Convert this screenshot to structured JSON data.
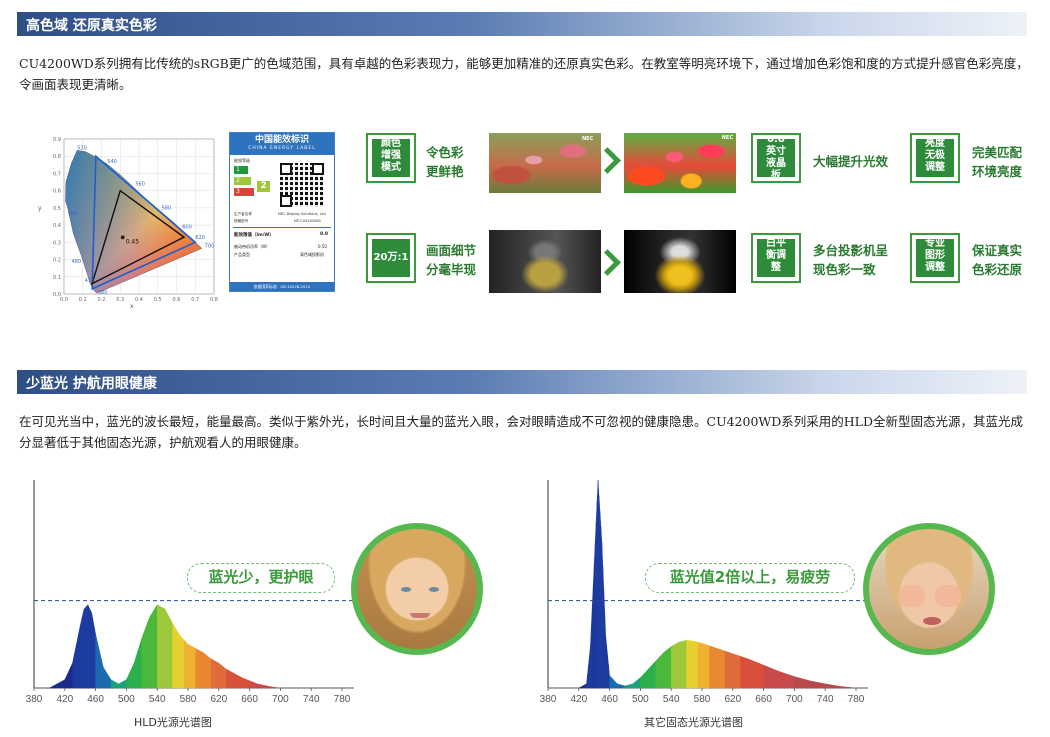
{
  "section1": {
    "heading": "高色域 还原真实色彩",
    "paragraph": "CU4200WD系列拥有比传统的sRGB更广的色域范围，具有卓越的色彩表现力，能够更加精准的还原真实色彩。在教室等明亮环境下，通过增加色彩饱和度的方式提升感官色彩亮度，令画面表现更清晰。"
  },
  "energy_label": {
    "title": "中国能效标识",
    "subtitle": "CHINA ENERGY LABEL",
    "grade_label": "能效等级",
    "grade_value": "2",
    "maker_label": "生产者名称",
    "maker_value": "NEC Display Solutions, Ltd.",
    "model_label": "规格型号",
    "model_value": "NP-CU4200WD",
    "row1_label": "能效限值（lm/W）",
    "row1_value": "8.0",
    "row2_label": "被动待机功率（W）",
    "row2_value": "0.50",
    "row3_label": "产品类型",
    "row3_value": "高色域投影机",
    "footer": "依据国家标准：GB 32028-2015"
  },
  "cie": {
    "xticks": [
      "0.0",
      "0.1",
      "0.2",
      "0.3",
      "0.4",
      "0.5",
      "0.6",
      "0.7",
      "0.8"
    ],
    "yticks": [
      "0.0",
      "0.1",
      "0.2",
      "0.3",
      "0.4",
      "0.5",
      "0.6",
      "0.7",
      "0.8",
      "0.9"
    ],
    "xlabel": "x",
    "ylabel": "y",
    "wavelengths": [
      "520",
      "540",
      "560",
      "580",
      "600",
      "620",
      "700",
      "490",
      "480",
      "470",
      "380"
    ],
    "white_point": "0.45"
  },
  "features": [
    {
      "icon_text": "颜色增强模式",
      "label1": "令色彩",
      "label2": "更鲜艳"
    },
    {
      "icon_text": "0.8英寸液晶板",
      "label1": "大幅提升光效",
      "label2": ""
    },
    {
      "icon_text": "亮度无极调整",
      "label1": "完美匹配",
      "label2": "环境亮度"
    },
    {
      "icon_text": "20万:1",
      "label1": "画面细节",
      "label2": "分毫毕现"
    },
    {
      "icon_text": "白平衡调整",
      "label1": "多台投影机呈",
      "label2": "现色彩一致"
    },
    {
      "icon_text": "专业图形调整",
      "label1": "保证真实",
      "label2": "色彩还原"
    }
  ],
  "photo_brand": "NEC",
  "section2": {
    "heading": "少蓝光 护航用眼健康",
    "paragraph": "在可见光当中，蓝光的波长最短，能量最高。类似于紫外光，长时间且大量的蓝光入眼，会对眼睛造成不可忽视的健康隐患。CU4200WD系列采用的HLD全新型固态光源，其蓝光成分显著低于其他固态光源，护航观看人的用眼健康。"
  },
  "chart_data": [
    {
      "type": "area",
      "title": "HLD光源光谱图",
      "xlabel": "",
      "ylabel": "",
      "x_ticks": [
        380,
        420,
        460,
        500,
        540,
        580,
        620,
        660,
        700,
        740,
        780
      ],
      "xlim": [
        380,
        780
      ],
      "ylim": [
        0,
        1
      ],
      "reference_line": 0.42,
      "badge": "蓝光少，更护眼",
      "x": [
        380,
        400,
        420,
        430,
        440,
        445,
        450,
        455,
        460,
        470,
        480,
        490,
        500,
        510,
        520,
        530,
        540,
        550,
        560,
        570,
        580,
        590,
        600,
        610,
        620,
        630,
        640,
        650,
        660,
        670,
        680,
        690,
        700
      ],
      "values": [
        0,
        0,
        0.04,
        0.12,
        0.3,
        0.38,
        0.4,
        0.36,
        0.26,
        0.1,
        0.04,
        0.02,
        0.04,
        0.12,
        0.24,
        0.34,
        0.4,
        0.38,
        0.31,
        0.25,
        0.21,
        0.19,
        0.17,
        0.14,
        0.12,
        0.09,
        0.07,
        0.05,
        0.035,
        0.02,
        0.012,
        0.005,
        0
      ]
    },
    {
      "type": "area",
      "title": "其它固态光源光谱图",
      "xlabel": "",
      "ylabel": "",
      "x_ticks": [
        380,
        420,
        460,
        500,
        540,
        580,
        620,
        660,
        700,
        740,
        780
      ],
      "xlim": [
        380,
        780
      ],
      "ylim": [
        0,
        1
      ],
      "reference_line": 0.42,
      "badge": "蓝光值2倍以上，易疲劳",
      "x": [
        380,
        420,
        430,
        435,
        440,
        445,
        450,
        455,
        460,
        470,
        480,
        490,
        500,
        510,
        520,
        530,
        540,
        550,
        560,
        570,
        580,
        600,
        620,
        640,
        660,
        680,
        700,
        720,
        740,
        760,
        780
      ],
      "values": [
        0,
        0,
        0.02,
        0.2,
        0.6,
        1.0,
        0.7,
        0.25,
        0.06,
        0.02,
        0.01,
        0.02,
        0.05,
        0.09,
        0.13,
        0.17,
        0.2,
        0.22,
        0.23,
        0.225,
        0.215,
        0.19,
        0.165,
        0.14,
        0.11,
        0.08,
        0.055,
        0.035,
        0.02,
        0.008,
        0
      ]
    }
  ]
}
